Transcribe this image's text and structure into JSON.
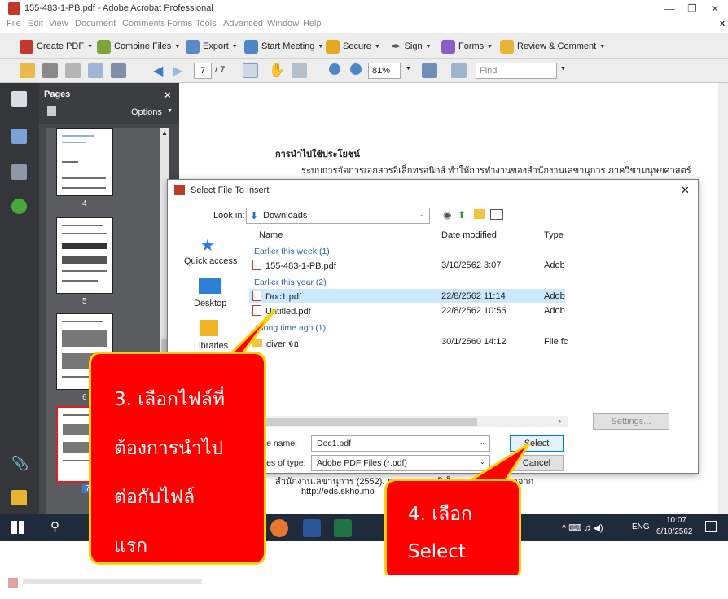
{
  "window": {
    "title": "155-483-1-PB.pdf - Adobe Acrobat Professional",
    "minimize_glyph": "—",
    "maximize_glyph": "❐",
    "close_glyph": "✕",
    "menu_close_glyph": "x"
  },
  "menu": [
    "File",
    "Edit",
    "View",
    "Document",
    "Comments",
    "Forms",
    "Tools",
    "Advanced",
    "Window",
    "Help"
  ],
  "toolbar1": {
    "create_pdf": "Create PDF",
    "combine_files": "Combine Files",
    "export": "Export",
    "start_meeting": "Start Meeting",
    "secure": "Secure",
    "sign": "Sign",
    "forms": "Forms",
    "review_comment": "Review & Comment"
  },
  "toolbar2": {
    "page_current": "7",
    "page_total": "/ 7",
    "zoom": "81%",
    "find_placeholder": "Find"
  },
  "pages_panel": {
    "title": "Pages",
    "close_glyph": "×",
    "options": "Options",
    "page_numbers": [
      "4",
      "5",
      "6",
      "7"
    ]
  },
  "document": {
    "heading": "การนำไปใช้ประโยชน์",
    "paragraph_line1": "ระบบการจัดการเอกสารอิเล็กทรอนิกส์ ทำให้การทำงานของสำนักงานเลขานุการ ภาควิชามนุษยศาสตร์",
    "footer_line1": "สำนักงานเลขานุการ (2552). ระบบเอกสารอิเล็กทรอนิกส์. ค้นหาจาก",
    "footer_line2": "http://eds.skho.mo"
  },
  "dialog": {
    "title": "Select File To Insert",
    "look_in_label": "Look in:",
    "look_in_value": "Downloads",
    "places": [
      "Quick access",
      "Desktop",
      "Libraries"
    ],
    "columns": {
      "name": "Name",
      "date": "Date modified",
      "type": "Type"
    },
    "groups": [
      "Earlier this week (1)",
      "Earlier this year (2)",
      "A long time ago (1)"
    ],
    "files": [
      {
        "name": "155-483-1-PB.pdf",
        "date": "3/10/2562 3:07",
        "type": "Adob"
      },
      {
        "name": "Doc1.pdf",
        "date": "22/8/2562 11:14",
        "type": "Adob"
      },
      {
        "name": "Untitled.pdf",
        "date": "22/8/2562 10:56",
        "type": "Adob"
      },
      {
        "name": "diver จอ",
        "date": "30/1/2560 14:12",
        "type": "File fc"
      }
    ],
    "file_name_label": "File name:",
    "file_name_value": "Doc1.pdf",
    "file_type_label": "Files of type:",
    "file_type_value": "Adobe PDF Files (*.pdf)",
    "select_button": "Select",
    "cancel_button": "Cancel",
    "settings_button": "Settings...",
    "close_glyph": "✕"
  },
  "taskbar": {
    "time": "10:07",
    "date": "6/10/2562",
    "language": "ENG",
    "tray_glyphs": "^ ⌨ ♫ ◀)"
  },
  "callouts": {
    "step3": [
      "3. เลือกไฟล์ที่",
      "ต้องการนำไป",
      "ต่อกับไฟล์",
      "แรก"
    ],
    "step4": [
      "4. เลือก",
      "Select"
    ]
  },
  "colors": {
    "callout_fill": "#ff0000",
    "callout_border": "#ffd200",
    "selected_row": "#cce8ff",
    "group_header": "#2a64b6"
  }
}
